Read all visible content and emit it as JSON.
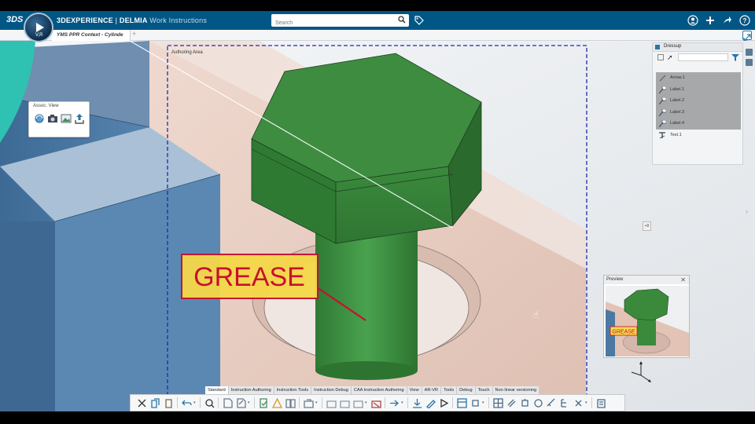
{
  "app": {
    "logo": "3DS",
    "brand_prefix": "3DEXPERIENCE",
    "brand_separator": " | ",
    "brand_name": "DELMIA",
    "app_name": "Work Instructions",
    "compass_version": "V,R"
  },
  "search": {
    "placeholder": "Search"
  },
  "tab": {
    "title": "YMS PPR Context - Cylinde",
    "add": "+"
  },
  "authoring_area": {
    "label": "Authoring Area"
  },
  "assoc_view": {
    "title": "Assoc. View",
    "icons": [
      "rotate-view-icon",
      "camera-icon",
      "image-icon",
      "export-icon"
    ]
  },
  "dressup": {
    "title": "Dressup",
    "items": [
      {
        "label": "Arrow.1",
        "selected": true,
        "icon": "arrow-icon"
      },
      {
        "label": "Label.1",
        "selected": true,
        "icon": "label-icon"
      },
      {
        "label": "Label.2",
        "selected": true,
        "icon": "label-icon"
      },
      {
        "label": "Label.3",
        "selected": true,
        "icon": "label-icon"
      },
      {
        "label": "Label.4",
        "selected": true,
        "icon": "label-icon"
      },
      {
        "label": "Text.1",
        "selected": false,
        "icon": "text-icon"
      }
    ]
  },
  "grease_label": {
    "text": "GREASE"
  },
  "preview": {
    "title": "Preview",
    "close": "✕",
    "label": "GREASE"
  },
  "mini_button": {
    "label": "+8"
  },
  "tool_tabs": [
    {
      "label": "Standard",
      "active": true
    },
    {
      "label": "Instruction Authoring",
      "active": false
    },
    {
      "label": "Instruction Tools",
      "active": false
    },
    {
      "label": "Instruction Debug",
      "active": false
    },
    {
      "label": "CAA Instruction Authoring",
      "active": false
    },
    {
      "label": "View",
      "active": false
    },
    {
      "label": "AR-VR",
      "active": false
    },
    {
      "label": "Tools",
      "active": false
    },
    {
      "label": "Debug",
      "active": false
    },
    {
      "label": "Touch",
      "active": false
    },
    {
      "label": "Non linear versioning",
      "active": false
    }
  ],
  "colors": {
    "topbar": "#005685",
    "bolt_green": "#3b8a3b",
    "grease_fill": "#f5d84a",
    "grease_text": "#c8102e",
    "authoring_border": "#1f2aa8",
    "plate": "#e6c9bd",
    "blue_block": "#4c79a3",
    "teal": "#2fc1b1"
  }
}
